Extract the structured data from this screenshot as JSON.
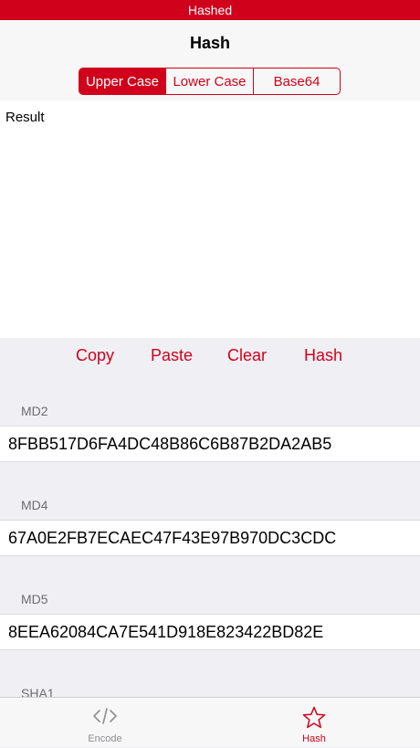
{
  "status_bar": {
    "title": "Hashed"
  },
  "nav": {
    "title": "Hash"
  },
  "segments": [
    {
      "label": "Upper Case",
      "active": true
    },
    {
      "label": "Lower Case",
      "active": false
    },
    {
      "label": "Base64",
      "active": false
    }
  ],
  "result": {
    "label": "Result"
  },
  "actions": {
    "copy": "Copy",
    "paste": "Paste",
    "clear": "Clear",
    "hash": "Hash"
  },
  "hashes": [
    {
      "name": "MD2",
      "value": "8FBB517D6FA4DC48B86C6B87B2DA2AB5"
    },
    {
      "name": "MD4",
      "value": "67A0E2FB7ECAEC47F43E97B970DC3CDC"
    },
    {
      "name": "MD5",
      "value": "8EEA62084CA7E541D918E823422BD82E"
    },
    {
      "name": "SHA1",
      "value": ""
    }
  ],
  "tabs": [
    {
      "label": "Encode",
      "icon": "code-icon",
      "active": false
    },
    {
      "label": "Hash",
      "icon": "star-icon",
      "active": true
    }
  ],
  "colors": {
    "accent": "#d0021b",
    "background": "#efeff4",
    "inactive": "#8e8e93"
  }
}
